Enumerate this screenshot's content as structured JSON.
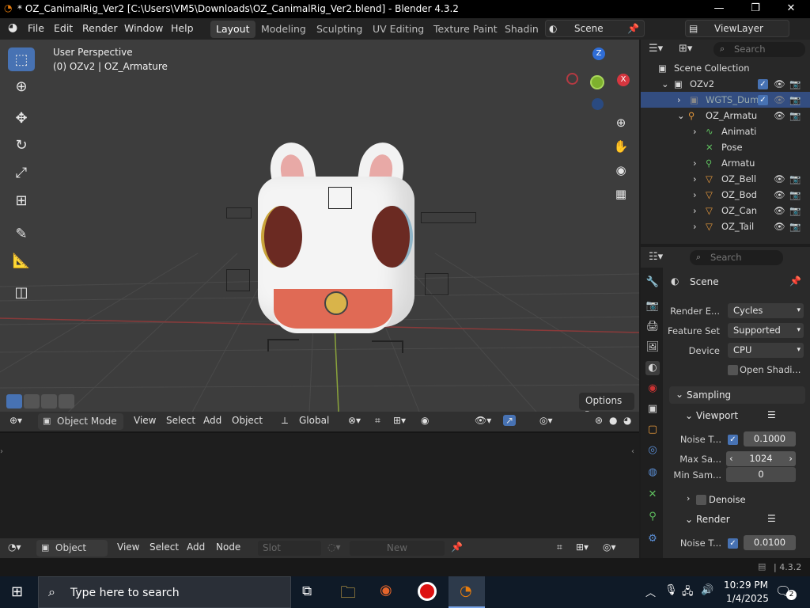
{
  "window": {
    "title": "* OZ_CanimalRig_Ver2 [C:\\Users\\VM5\\Downloads\\OZ_CanimalRig_Ver2.blend] - Blender 4.3.2"
  },
  "menu": {
    "items": [
      "File",
      "Edit",
      "Render",
      "Window",
      "Help"
    ]
  },
  "workspaces": {
    "tabs": [
      "Layout",
      "Modeling",
      "Sculpting",
      "UV Editing",
      "Texture Paint",
      "Shading"
    ],
    "active": "Layout"
  },
  "scene": {
    "label": "Scene",
    "view_layer": "ViewLayer"
  },
  "viewport": {
    "perspective": "User Perspective",
    "object_info": "(0) OZv2 | OZ_Armature",
    "options_label": "Options",
    "gizmo": {
      "x": "X",
      "y": "Y",
      "z": "Z"
    }
  },
  "viewport_header": {
    "mode": "Object Mode",
    "view": "View",
    "select": "Select",
    "add": "Add",
    "object": "Object",
    "transform": "Global"
  },
  "shader_header": {
    "type": "Object",
    "view": "View",
    "select": "Select",
    "add": "Add",
    "node": "Node",
    "slot": "Slot",
    "new": "New"
  },
  "outliner": {
    "search_placeholder": "Search",
    "root": "Scene Collection",
    "rows": [
      {
        "label": "OZv2"
      },
      {
        "label": "WGTS_Dum"
      },
      {
        "label": "OZ_Armatu"
      },
      {
        "label": "Animati"
      },
      {
        "label": "Pose"
      },
      {
        "label": "Armatu"
      },
      {
        "label": "OZ_Bell"
      },
      {
        "label": "OZ_Bod"
      },
      {
        "label": "OZ_Can"
      },
      {
        "label": "OZ_Tail"
      }
    ]
  },
  "properties": {
    "search_placeholder": "Search",
    "context": "Scene",
    "render_engine_label": "Render E...",
    "render_engine": "Cycles",
    "feature_set_label": "Feature Set",
    "feature_set": "Supported",
    "device_label": "Device",
    "device": "CPU",
    "open_shading": "Open Shadi...",
    "sampling": "Sampling",
    "viewport": "Viewport",
    "noise_threshold_label": "Noise T...",
    "noise_threshold": "0.1000",
    "max_samples_label": "Max Sa...",
    "max_samples": "1024",
    "min_samples_label": "Min Sam...",
    "min_samples": "0",
    "denoise": "Denoise",
    "render": "Render",
    "render_noise_label": "Noise T...",
    "render_noise": "0.0100"
  },
  "status": {
    "version": "4.3.2"
  },
  "taskbar": {
    "search_placeholder": "Type here to search",
    "time": "10:29 PM",
    "date": "1/4/2025",
    "notifications": "2"
  }
}
